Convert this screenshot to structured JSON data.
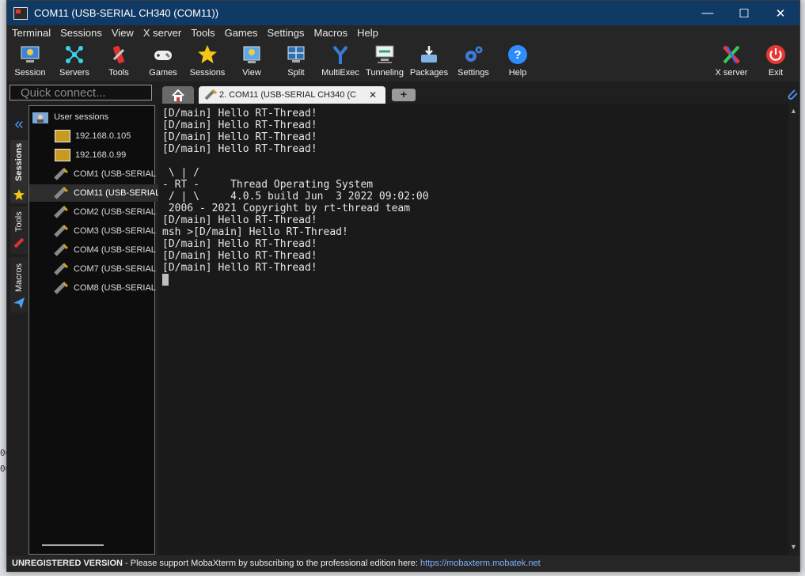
{
  "window": {
    "title": "COM11  (USB-SERIAL CH340 (COM11))",
    "minimize": "—",
    "maximize": "☐",
    "close": "✕"
  },
  "menu": [
    "Terminal",
    "Sessions",
    "View",
    "X server",
    "Tools",
    "Games",
    "Settings",
    "Macros",
    "Help"
  ],
  "toolbar": {
    "session": "Session",
    "servers": "Servers",
    "tools": "Tools",
    "games": "Games",
    "sessions": "Sessions",
    "view": "View",
    "split": "Split",
    "multiexec": "MultiExec",
    "tunneling": "Tunneling",
    "packages": "Packages",
    "settings": "Settings",
    "help": "Help",
    "xserver": "X server",
    "exit": "Exit"
  },
  "quick_connect": {
    "placeholder": "Quick connect..."
  },
  "tabs": {
    "active_label": "2. COM11  (USB-SERIAL CH340 (C",
    "add": "+"
  },
  "side_tabs": {
    "sessions": "Sessions",
    "tools": "Tools",
    "macros": "Macros"
  },
  "sessions_panel": {
    "root": "User sessions",
    "items": [
      {
        "label": "192.168.0.105"
      },
      {
        "label": "192.168.0.99"
      },
      {
        "label": "COM1  (USB-SERIAL"
      },
      {
        "label": "COM11  (USB-SERIAL"
      },
      {
        "label": "COM2  (USB-SERIAL"
      },
      {
        "label": "COM3  (USB-SERIAL"
      },
      {
        "label": "COM4  (USB-SERIAL"
      },
      {
        "label": "COM7  (USB-SERIAL"
      },
      {
        "label": "COM8  (USB-SERIAL"
      }
    ]
  },
  "terminal": {
    "lines": [
      "[D/main] Hello RT-Thread!",
      "[D/main] Hello RT-Thread!",
      "[D/main] Hello RT-Thread!",
      "[D/main] Hello RT-Thread!",
      "",
      " \\ | /",
      "- RT -     Thread Operating System",
      " / | \\     4.0.5 build Jun  3 2022 09:02:00",
      " 2006 - 2021 Copyright by rt-thread team",
      "[D/main] Hello RT-Thread!",
      "msh >[D/main] Hello RT-Thread!",
      "[D/main] Hello RT-Thread!",
      "[D/main] Hello RT-Thread!",
      "[D/main] Hello RT-Thread!"
    ]
  },
  "status": {
    "unregistered": "UNREGISTERED VERSION",
    "message": "  -  Please support MobaXterm by subscribing to the professional edition here:  ",
    "link": "https://mobaxterm.mobatek.net"
  },
  "colors": {
    "titlebar": "#0f3a66",
    "link": "#7fb2ff",
    "accent_blue": "#2f8cff"
  }
}
